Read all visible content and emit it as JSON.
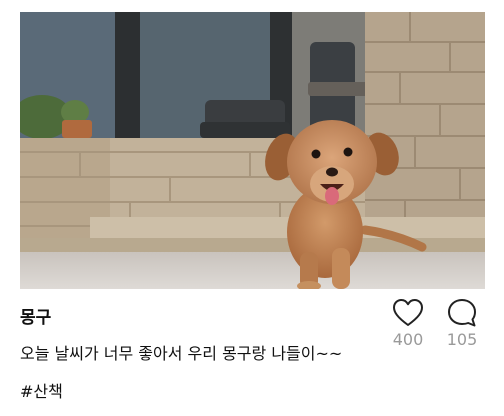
{
  "post": {
    "photo_alt": "",
    "username": "몽구",
    "caption": "오늘 날씨가 너무 좋아서 우리 몽구랑 나들이~~",
    "hashtag": "#산책",
    "likes": {
      "icon": "heart-icon",
      "count": "400"
    },
    "comments": {
      "icon": "speech-bubble-icon",
      "count": "105"
    }
  },
  "colors": {
    "text": "#111111",
    "count": "#9a9a9a",
    "icon_stroke": "#222222"
  }
}
